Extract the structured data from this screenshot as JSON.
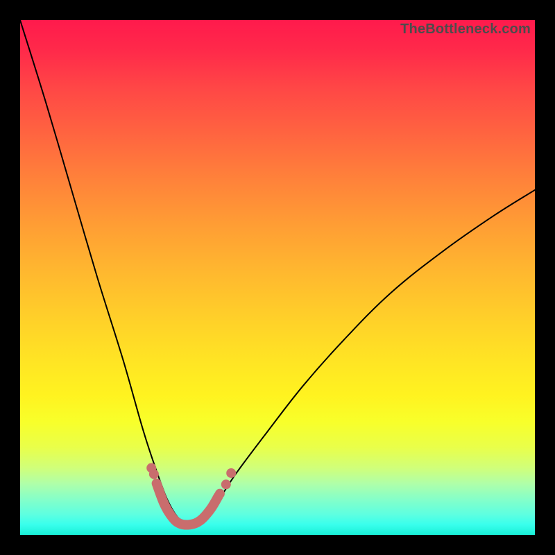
{
  "watermark": "TheBottleneck.com",
  "colors": {
    "frame_background": "#000000",
    "curve_stroke": "#000000",
    "overlay_stroke": "#c96d6d",
    "gradient_top": "#ff1a4c",
    "gradient_bottom": "#19f0d8"
  },
  "chart_data": {
    "type": "line",
    "title": "",
    "xlabel": "",
    "ylabel": "",
    "xlim": [
      0,
      100
    ],
    "ylim": [
      0,
      100
    ],
    "grid": false,
    "legend": false,
    "series": [
      {
        "name": "bottleneck-curve",
        "x": [
          0,
          5,
          10,
          15,
          20,
          24,
          27,
          29,
          31,
          33,
          35,
          38,
          42,
          48,
          55,
          63,
          72,
          82,
          92,
          100
        ],
        "values": [
          100,
          84,
          67,
          50,
          34,
          20,
          11,
          6,
          3,
          2,
          3,
          6,
          12,
          20,
          29,
          38,
          47,
          55,
          62,
          67
        ]
      },
      {
        "name": "highlight-band",
        "x": [
          26.5,
          28,
          29.5,
          31,
          33,
          35,
          37,
          38.5
        ],
        "values": [
          10,
          6,
          3.5,
          2.2,
          2.0,
          2.8,
          5.0,
          7.5
        ]
      },
      {
        "name": "highlight-dots",
        "x": [
          25.5,
          26.0,
          38.8,
          40.0,
          41.0
        ],
        "values": [
          13.0,
          11.8,
          8.0,
          9.8,
          12.0
        ]
      }
    ],
    "annotations": []
  }
}
